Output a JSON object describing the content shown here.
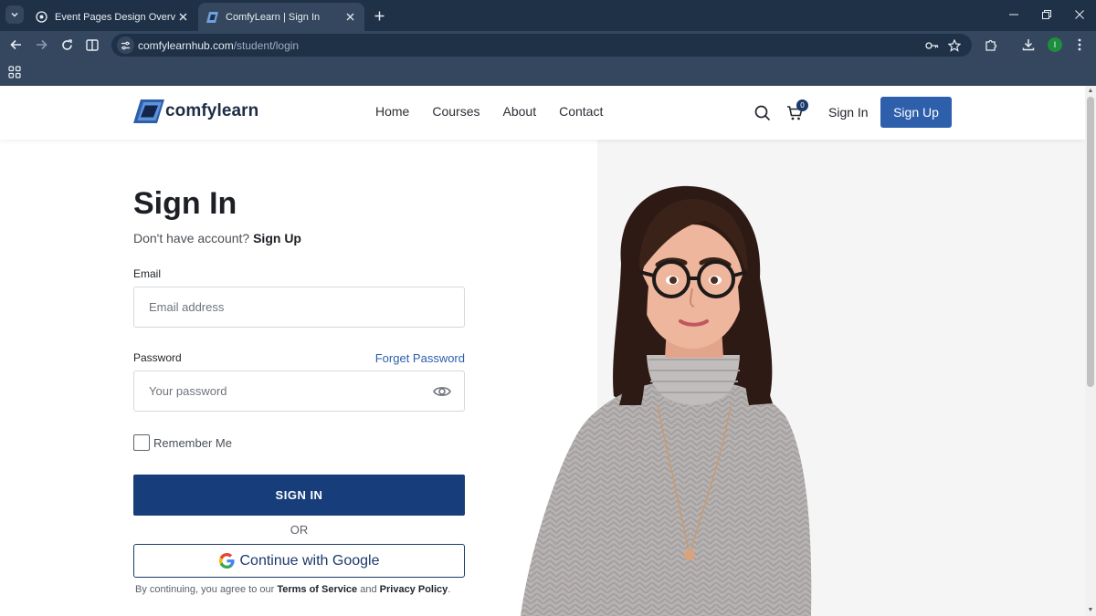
{
  "browser": {
    "tabs": [
      {
        "title": "Event Pages Design Overview",
        "active": false
      },
      {
        "title": "ComfyLearn | Sign In",
        "active": true
      }
    ],
    "url_host": "comfylearnhub.com",
    "url_path": "/student/login",
    "profile_initial": "I"
  },
  "header": {
    "logo_text": "comfylearn",
    "nav": [
      "Home",
      "Courses",
      "About",
      "Contact"
    ],
    "cart_count": "0",
    "signin_label": "Sign In",
    "signup_label": "Sign Up"
  },
  "form": {
    "title": "Sign In",
    "prompt": "Don't have account?",
    "prompt_link": "Sign Up",
    "email_label": "Email",
    "email_placeholder": "Email address",
    "password_label": "Password",
    "forgot_label": "Forget Password",
    "password_placeholder": "Your password",
    "remember_label": "Remember Me",
    "submit_label": "SIGN IN",
    "or_label": "OR",
    "google_label": "Continue with Google",
    "legal_prefix": "By continuing, you agree to our",
    "terms_label": "Terms of Service",
    "legal_and": "and",
    "privacy_label": "Privacy Policy",
    "legal_suffix": "."
  },
  "colors": {
    "brand_navy": "#173d7b",
    "header_button": "#2d5fab",
    "panel_bg": "#f5f5f5"
  }
}
